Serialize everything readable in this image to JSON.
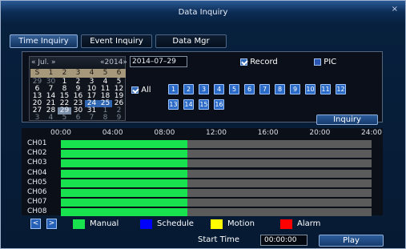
{
  "window": {
    "title": "Data Inquiry",
    "close_glyph": "×"
  },
  "tabs": [
    {
      "label": "Time Inquiry",
      "active": true
    },
    {
      "label": "Event Inquiry",
      "active": false
    },
    {
      "label": "Data Mgr",
      "active": false
    }
  ],
  "calendar": {
    "month": "Jul.",
    "year": "2014",
    "prev_glyph": "«",
    "next_glyph": "»",
    "weekdays": [
      "S",
      "1",
      "2",
      "3",
      "4",
      "5",
      "6"
    ],
    "days": [
      [
        "29",
        "30",
        "1",
        "2",
        "3",
        "4",
        "5"
      ],
      [
        "6",
        "7",
        "8",
        "9",
        "10",
        "11",
        "12"
      ],
      [
        "13",
        "14",
        "15",
        "16",
        "17",
        "18",
        "19"
      ],
      [
        "20",
        "21",
        "22",
        "23",
        "24",
        "25",
        "26"
      ],
      [
        "27",
        "28",
        "29",
        "30",
        "31",
        "1",
        "2"
      ],
      [
        "3",
        "4",
        "5",
        "6",
        "7",
        "8",
        "9"
      ]
    ],
    "highlighted": [
      "24",
      "25"
    ],
    "selected": "29"
  },
  "date_field": {
    "value": "2014–07–29"
  },
  "checkboxes": {
    "record": {
      "label": "Record",
      "checked": true
    },
    "pic": {
      "label": "PIC",
      "checked": false
    },
    "all": {
      "label": "All",
      "checked": true
    }
  },
  "channels_buttons": [
    "1",
    "2",
    "3",
    "4",
    "5",
    "6",
    "7",
    "8",
    "9",
    "10",
    "11",
    "12",
    "13",
    "14",
    "15",
    "16"
  ],
  "inquiry_button": "Inquiry",
  "timeline": {
    "ticks": [
      "00:00",
      "04:00",
      "08:00",
      "12:00",
      "16:00",
      "20:00",
      "24:00"
    ],
    "channels": [
      "CH01",
      "CH02",
      "CH03",
      "CH04",
      "CH05",
      "CH06",
      "CH07",
      "CH08"
    ],
    "recorded_until_hour": 9.8
  },
  "legend": [
    {
      "label": "Manual",
      "color": "#19e24f"
    },
    {
      "label": "Schedule",
      "color": "#0000ff"
    },
    {
      "label": "Motion",
      "color": "#ffff00"
    },
    {
      "label": "Alarm",
      "color": "#ff0000"
    }
  ],
  "nav": {
    "prev_glyph": "<",
    "next_glyph": ">"
  },
  "start_time": {
    "label": "Start Time",
    "value": "00:00:00"
  },
  "play_button": "Play"
}
